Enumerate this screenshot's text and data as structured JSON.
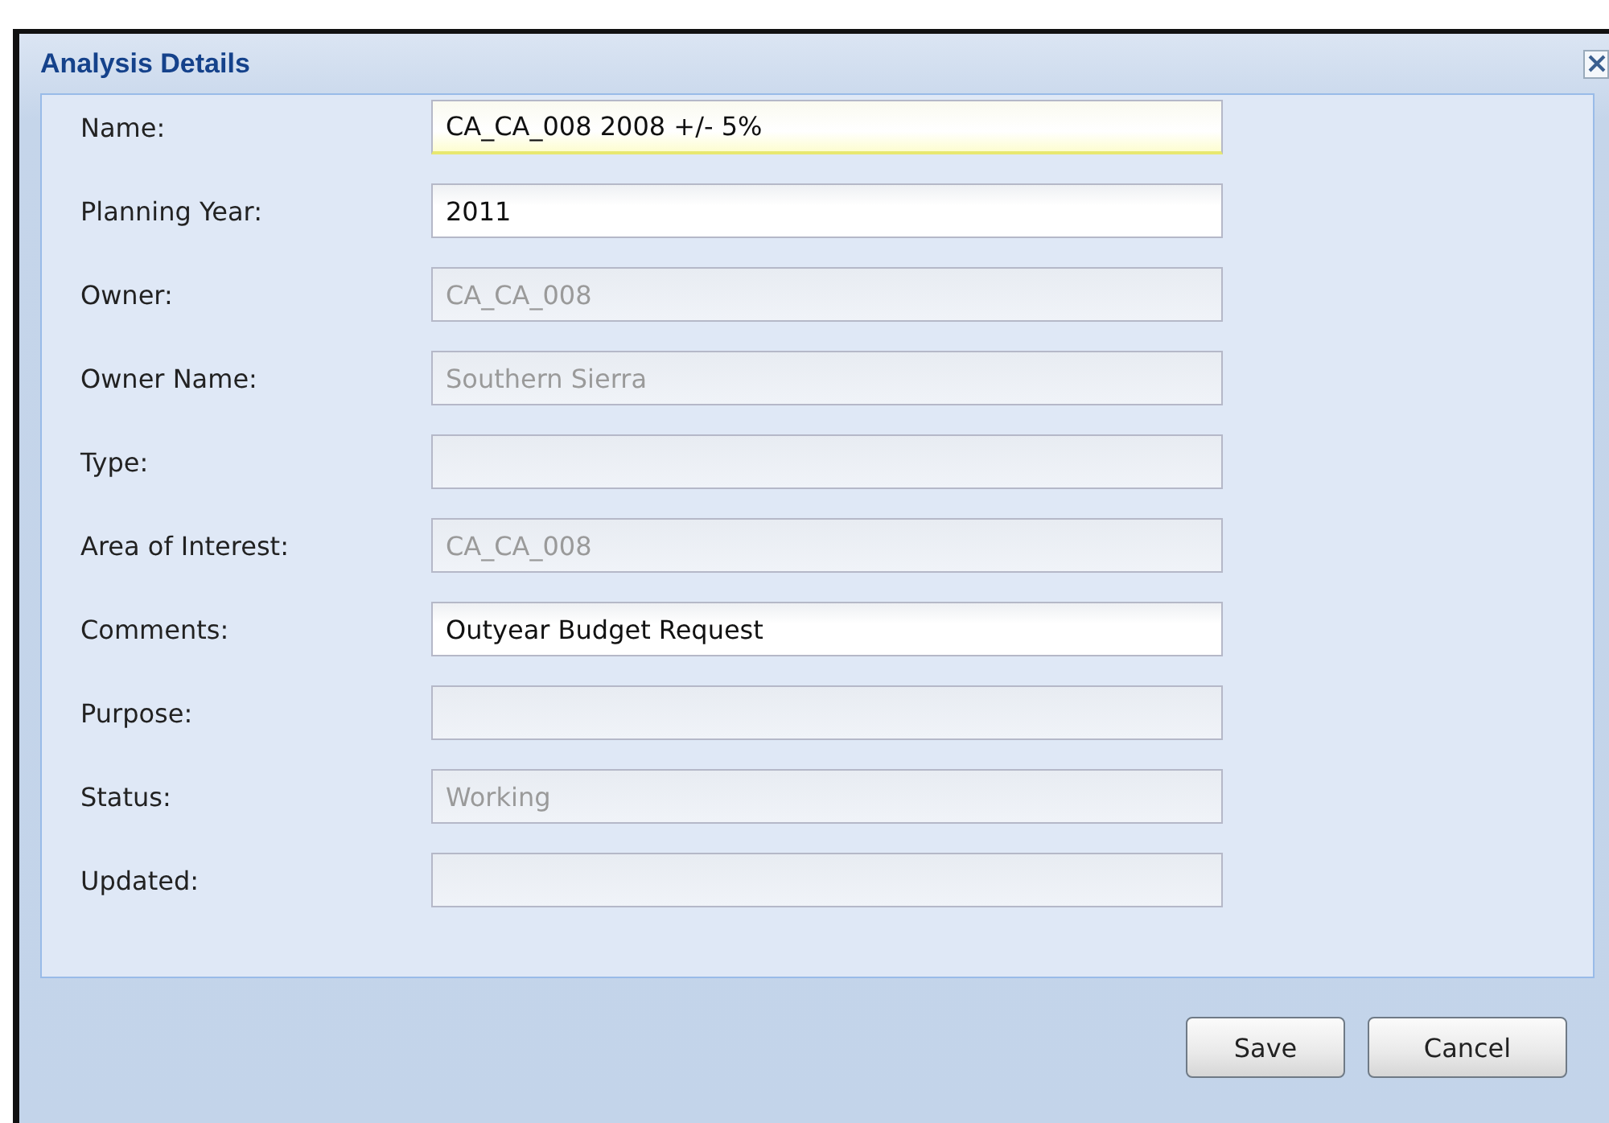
{
  "dialog": {
    "title": "Analysis Details",
    "fields": [
      {
        "label": "Name:",
        "value": "CA_CA_008 2008 +/- 5%",
        "disabled": false,
        "focused": true
      },
      {
        "label": "Planning Year:",
        "value": "2011",
        "disabled": false,
        "focused": false
      },
      {
        "label": "Owner:",
        "value": "CA_CA_008",
        "disabled": true,
        "focused": false
      },
      {
        "label": "Owner Name:",
        "value": "Southern Sierra",
        "disabled": true,
        "focused": false
      },
      {
        "label": "Type:",
        "disabled": true,
        "focused": false
      },
      {
        "label": "Area of Interest:",
        "value": "CA_CA_008",
        "disabled": true,
        "focused": false
      },
      {
        "label": "Comments:",
        "value": "Outyear Budget Request",
        "disabled": false,
        "focused": false
      },
      {
        "label": "Purpose:",
        "disabled": true,
        "focused": false
      },
      {
        "label": "Status:",
        "value": "Working",
        "disabled": true,
        "focused": false
      },
      {
        "label": "Updated:",
        "disabled": true,
        "focused": false
      }
    ],
    "buttons": [
      "Save",
      "Cancel"
    ]
  }
}
